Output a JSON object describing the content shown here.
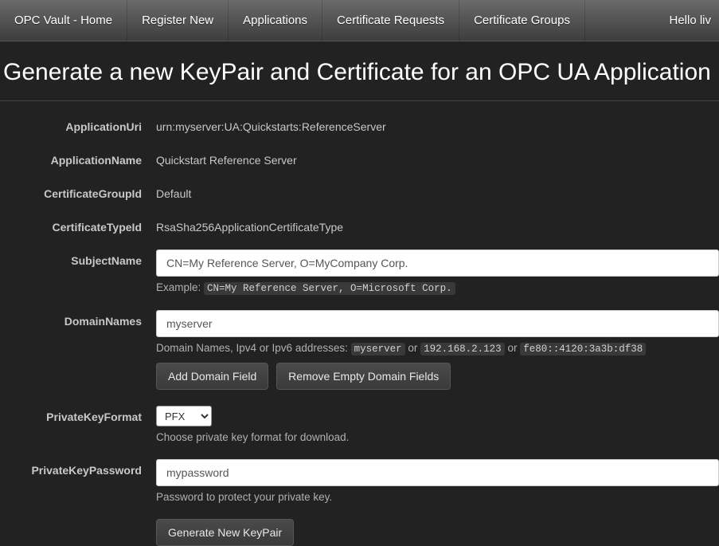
{
  "nav": {
    "brand": "OPC Vault - Home",
    "items": [
      "Register New",
      "Applications",
      "Certificate Requests",
      "Certificate Groups"
    ],
    "user_greeting": "Hello liv"
  },
  "page_title": "Generate a new KeyPair and Certificate for an OPC UA Application",
  "fields": {
    "application_uri": {
      "label": "ApplicationUri",
      "value": "urn:myserver:UA:Quickstarts:ReferenceServer"
    },
    "application_name": {
      "label": "ApplicationName",
      "value": "Quickstart Reference Server"
    },
    "certificate_group_id": {
      "label": "CertificateGroupId",
      "value": "Default"
    },
    "certificate_type_id": {
      "label": "CertificateTypeId",
      "value": "RsaSha256ApplicationCertificateType"
    },
    "subject_name": {
      "label": "SubjectName",
      "value": "CN=My Reference Server, O=MyCompany Corp.",
      "example_prefix": "Example: ",
      "example_code": "CN=My Reference Server, O=Microsoft Corp."
    },
    "domain_names": {
      "label": "DomainNames",
      "value": "myserver",
      "hint_prefix": "Domain Names, Ipv4 or Ipv6 addresses: ",
      "hint_code1": "myserver",
      "hint_or": " or ",
      "hint_code2": "192.168.2.123",
      "hint_code3": "fe80::4120:3a3b:df38",
      "add_button": "Add Domain Field",
      "remove_button": "Remove Empty Domain Fields"
    },
    "private_key_format": {
      "label": "PrivateKeyFormat",
      "selected": "PFX",
      "options": [
        "PFX"
      ],
      "hint": "Choose private key format for download."
    },
    "private_key_password": {
      "label": "PrivateKeyPassword",
      "value": "mypassword",
      "hint": "Password to protect your private key."
    }
  },
  "submit_button": "Generate New KeyPair"
}
